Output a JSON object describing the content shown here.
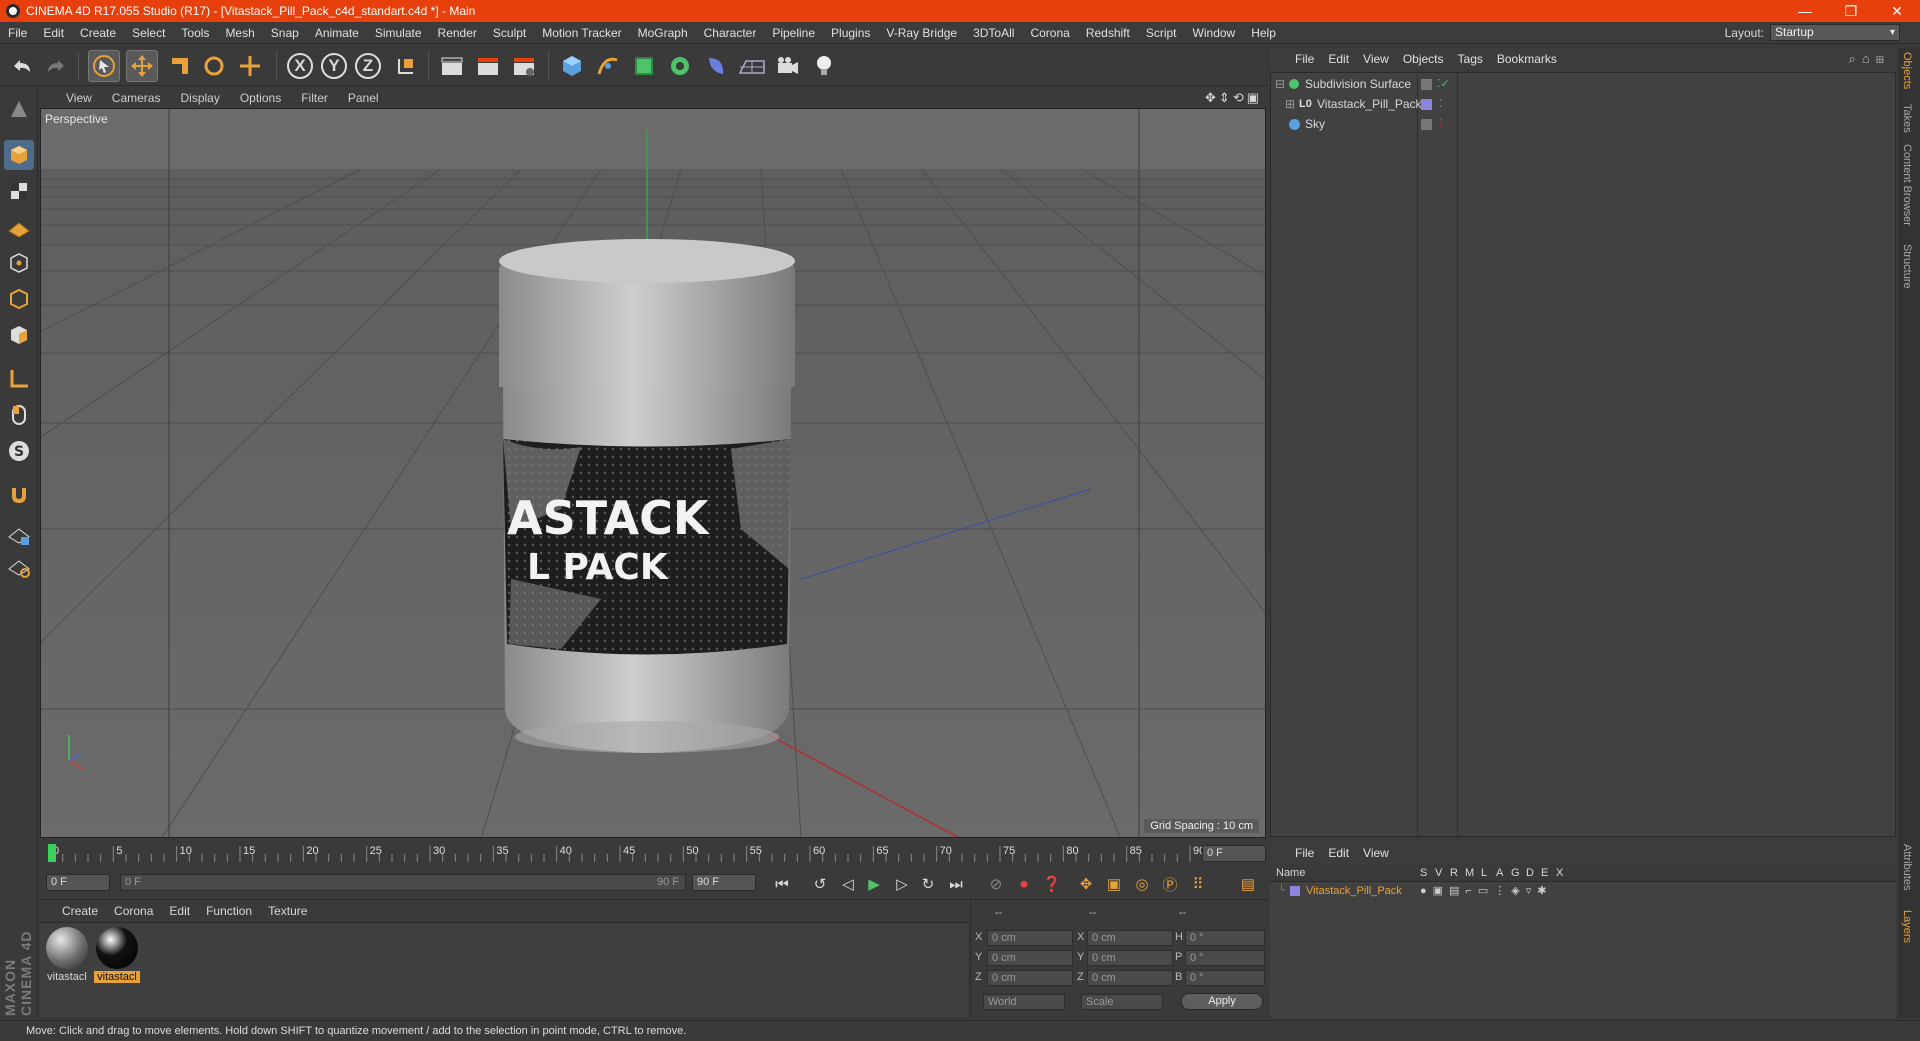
{
  "window": {
    "title": "CINEMA 4D R17.055 Studio (R17) - [Vitastack_Pill_Pack_c4d_standart.c4d *] - Main",
    "controls": [
      "—",
      "❐",
      "✕"
    ]
  },
  "menu": [
    "File",
    "Edit",
    "Create",
    "Select",
    "Tools",
    "Mesh",
    "Snap",
    "Animate",
    "Simulate",
    "Render",
    "Sculpt",
    "Motion Tracker",
    "MoGraph",
    "Character",
    "Pipeline",
    "Plugins",
    "V-Ray Bridge",
    "3DToAll",
    "Corona",
    "Redshift",
    "Script",
    "Window",
    "Help"
  ],
  "layout": {
    "label": "Layout:",
    "value": "Startup"
  },
  "toolbar": {
    "axis_x": "X",
    "axis_y": "Y",
    "axis_z": "Z"
  },
  "viewport": {
    "menu": [
      "View",
      "Cameras",
      "Display",
      "Options",
      "Filter",
      "Panel"
    ],
    "label": "Perspective",
    "grid_spacing": "Grid Spacing : 10 cm",
    "label_line1": "ASTACK",
    "label_line2": "L PACK"
  },
  "timeline": {
    "ticks": [
      "0",
      "5",
      "10",
      "15",
      "20",
      "25",
      "30",
      "35",
      "40",
      "45",
      "50",
      "55",
      "60",
      "65",
      "70",
      "75",
      "80",
      "85",
      "90"
    ],
    "current_frame": "0 F"
  },
  "playback": {
    "start": "0 F",
    "range_start": "0 F",
    "range_end": "90 F",
    "end": "90 F"
  },
  "material_manager": {
    "menu": [
      "Create",
      "Corona",
      "Edit",
      "Function",
      "Texture"
    ],
    "materials": [
      {
        "name": "vitastacl",
        "selected": false
      },
      {
        "name": "vitastacl",
        "selected": true
      }
    ]
  },
  "coordinates": {
    "headers": [
      "--",
      "--",
      "--"
    ],
    "rows": [
      {
        "axis": "X",
        "pos": "0 cm",
        "axis2": "X",
        "size": "0 cm",
        "rot_label": "H",
        "rot": "0 °"
      },
      {
        "axis": "Y",
        "pos": "0 cm",
        "axis2": "Y",
        "size": "0 cm",
        "rot_label": "P",
        "rot": "0 °"
      },
      {
        "axis": "Z",
        "pos": "0 cm",
        "axis2": "Z",
        "size": "0 cm",
        "rot_label": "B",
        "rot": "0 °"
      }
    ],
    "mode": "World",
    "scale": "Scale",
    "apply": "Apply"
  },
  "object_manager": {
    "menu": [
      "File",
      "Edit",
      "View",
      "Objects",
      "Tags",
      "Bookmarks"
    ],
    "objects": [
      {
        "name": "Subdivision Surface",
        "color": "#5fd17a"
      },
      {
        "name": "Vitastack_Pill_Pack",
        "color": "#d8d8d8"
      },
      {
        "name": "Sky",
        "color": "#d8d8d8"
      }
    ]
  },
  "layer_manager": {
    "menu": [
      "File",
      "Edit",
      "View"
    ],
    "columns": [
      "Name",
      "S",
      "V",
      "R",
      "M",
      "L",
      "A",
      "G",
      "D",
      "E",
      "X"
    ],
    "layers": [
      {
        "name": "Vitastack_Pill_Pack",
        "color": "#e8a23a"
      }
    ]
  },
  "right_tabs": [
    "Objects",
    "Takes",
    "Content Browser",
    "Structure",
    "Attributes",
    "Layers"
  ],
  "status": "Move: Click and drag to move elements. Hold down SHIFT to quantize movement / add to the selection in point mode, CTRL to remove.",
  "brand": "MAXON CINEMA 4D",
  "colors": {
    "accent": "#e8400c",
    "selection": "#e8a23a",
    "viewport_bg": "#6b6b6b"
  }
}
